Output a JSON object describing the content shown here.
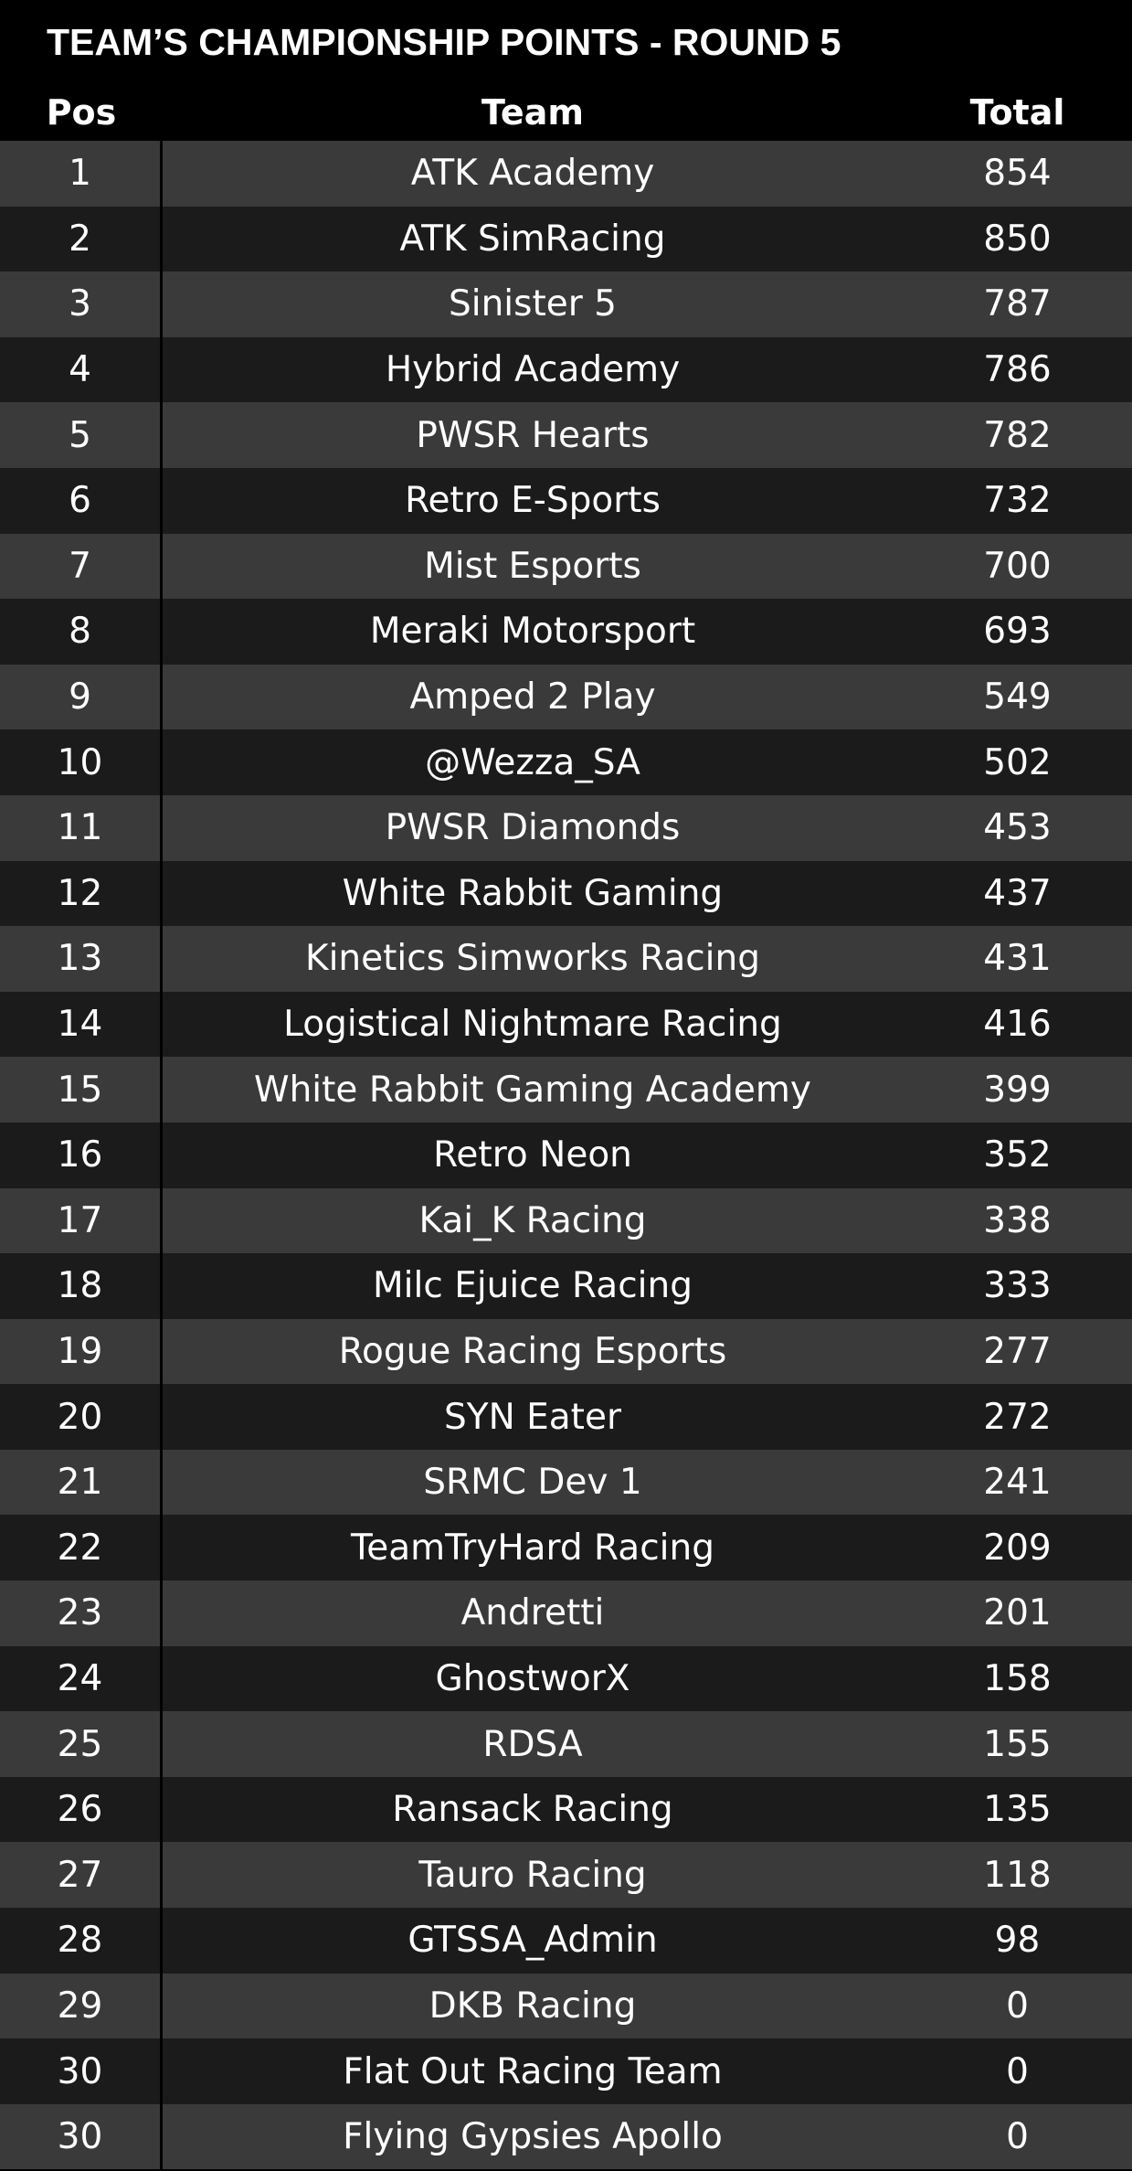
{
  "title": "TEAM’S CHAMPIONSHIP POINTS - ROUND 5",
  "columns": {
    "pos": "Pos",
    "team": "Team",
    "total": "Total"
  },
  "rows": [
    {
      "pos": "1",
      "team": "ATK Academy",
      "total": "854"
    },
    {
      "pos": "2",
      "team": "ATK SimRacing",
      "total": "850"
    },
    {
      "pos": "3",
      "team": "Sinister 5",
      "total": "787"
    },
    {
      "pos": "4",
      "team": "Hybrid Academy",
      "total": "786"
    },
    {
      "pos": "5",
      "team": "PWSR Hearts",
      "total": "782"
    },
    {
      "pos": "6",
      "team": "Retro E-Sports",
      "total": "732"
    },
    {
      "pos": "7",
      "team": "Mist Esports",
      "total": "700"
    },
    {
      "pos": "8",
      "team": "Meraki Motorsport",
      "total": "693"
    },
    {
      "pos": "9",
      "team": "Amped 2 Play",
      "total": "549"
    },
    {
      "pos": "10",
      "team": "@Wezza_SA",
      "total": "502"
    },
    {
      "pos": "11",
      "team": "PWSR Diamonds",
      "total": "453"
    },
    {
      "pos": "12",
      "team": "White Rabbit Gaming",
      "total": "437"
    },
    {
      "pos": "13",
      "team": "Kinetics Simworks Racing",
      "total": "431"
    },
    {
      "pos": "14",
      "team": "Logistical Nightmare Racing",
      "total": "416"
    },
    {
      "pos": "15",
      "team": "White Rabbit Gaming Academy",
      "total": "399"
    },
    {
      "pos": "16",
      "team": "Retro Neon",
      "total": "352"
    },
    {
      "pos": "17",
      "team": "Kai_K Racing",
      "total": "338"
    },
    {
      "pos": "18",
      "team": "Milc Ejuice Racing",
      "total": "333"
    },
    {
      "pos": "19",
      "team": "Rogue Racing Esports",
      "total": "277"
    },
    {
      "pos": "20",
      "team": "SYN Eater",
      "total": "272"
    },
    {
      "pos": "21",
      "team": "SRMC Dev 1",
      "total": "241"
    },
    {
      "pos": "22",
      "team": "TeamTryHard Racing",
      "total": "209"
    },
    {
      "pos": "23",
      "team": "Andretti",
      "total": "201"
    },
    {
      "pos": "24",
      "team": "GhostworX",
      "total": "158"
    },
    {
      "pos": "25",
      "team": "RDSA",
      "total": "155"
    },
    {
      "pos": "26",
      "team": "Ransack Racing",
      "total": "135"
    },
    {
      "pos": "27",
      "team": "Tauro Racing",
      "total": "118"
    },
    {
      "pos": "28",
      "team": "GTSSA_Admin",
      "total": "98"
    },
    {
      "pos": "29",
      "team": "DKB Racing",
      "total": "0"
    },
    {
      "pos": "30",
      "team": "Flat Out Racing Team",
      "total": "0"
    },
    {
      "pos": "30",
      "team": "Flying Gypsies Apollo",
      "total": "0"
    }
  ],
  "colors": {
    "background": "#000000",
    "row_light": "#3a3a3a",
    "row_dark": "#1b1b1c",
    "text": "#ffffff"
  }
}
